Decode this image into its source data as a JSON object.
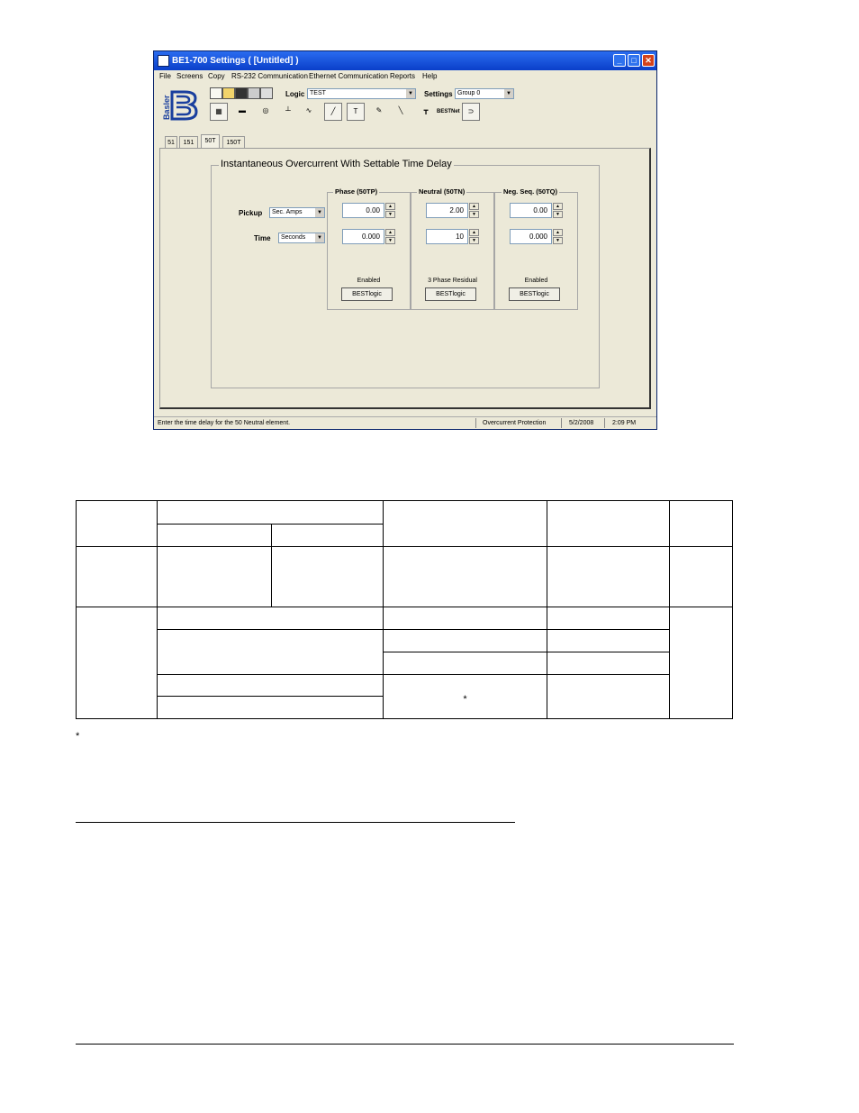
{
  "window": {
    "title": "BE1-700 Settings   ( [Untitled] )",
    "controls": [
      "_",
      "□",
      "✕"
    ],
    "menu": [
      "File",
      "Screens",
      "Copy",
      "RS-232 Communication",
      "Ethernet Communication",
      "Reports",
      "Help"
    ],
    "logo_text": "Basler",
    "toolbar": {
      "logic_label": "Logic",
      "logic_value": "TEST",
      "settings_label": "Settings",
      "settings_value": "Group 0",
      "bestnet_label": "BESTNet"
    },
    "tabs": [
      "51",
      "151",
      "50T",
      "150T"
    ],
    "active_tab": "50T",
    "group_title": "Instantaneous Overcurrent With Settable Time Delay",
    "pickup_label": "Pickup",
    "pickup_units": "Sec. Amps",
    "time_label": "Time",
    "time_units": "Seconds",
    "columns": [
      {
        "title": "Phase (50TP)",
        "pickup": "0.00",
        "time": "0.000",
        "status": "Enabled",
        "button": "BESTlogic"
      },
      {
        "title": "Neutral (50TN)",
        "pickup": "2.00",
        "time": "10",
        "status": "3 Phase Residual",
        "button": "BESTlogic"
      },
      {
        "title": "Neg. Seq. (50TQ)",
        "pickup": "0.00",
        "time": "0.000",
        "status": "Enabled",
        "button": "BESTlogic"
      }
    ],
    "status": {
      "message": "Enter the time delay for the 50 Neutral element.",
      "screen": "Overcurrent Protection",
      "date": "5/2/2008",
      "time": "2:09 PM"
    }
  },
  "table": {
    "merged_cell_mark": "*"
  },
  "footnote_mark": "*"
}
